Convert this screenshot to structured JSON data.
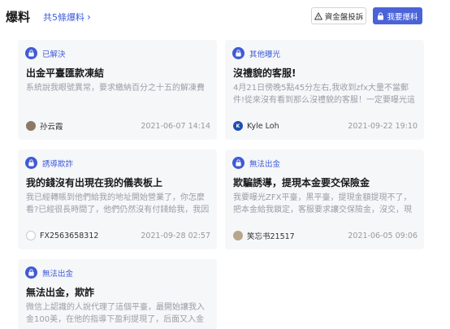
{
  "header": {
    "title": "爆料",
    "count_link": "共5條爆料",
    "complaint_button": "資金盤投訴",
    "report_button": "我要爆料"
  },
  "cards": [
    {
      "tag": "已解決",
      "title": "出金平臺匯款凍結",
      "desc": "系統說我眼號異常，要求繳納百分之十五的解凍費",
      "author": "孙云霞",
      "date": "2021-06-07 14:14"
    },
    {
      "tag": "其他曝光",
      "title": "沒禮貌的客服!",
      "desc": "4月21日傍晚5點45分左右,我收到zfx大量不當郵件!從來沒有看到那么沒禮貌的客服！一定要曝光這種垃圾...",
      "author": "Kyle Loh",
      "avatar_text": "K",
      "date": "2021-09-22 19:10"
    },
    {
      "tag": "誘導欺詐",
      "title": "我的錢沒有出現在我的儀表板上",
      "desc": "我已經轉賬到他們給我的地址開始營業了，你怎麼看?已經很長時間了，他們仍然沒有付錢給我，我因為調...",
      "author": "FX2563658312",
      "date": "2021-09-28 02:57"
    },
    {
      "tag": "無法出金",
      "title": "欺騙誘導，提現本金要交保險金",
      "desc": "我要曝光ZFX平臺，黑平臺，提現金額提現不了，把本金給我鎖定，客服要求讓交保險金，沒交，現在和客...",
      "author": "笑忘书21517",
      "date": "2021-06-05 09:06"
    },
    {
      "tag": "無法出金",
      "title": "無法出金，欺詐",
      "desc": "微信上認識的人說代理了這個平臺，最開始讓我入金100美，在他的指導下盈利提現了，后面又入金500...",
      "author": "",
      "date": ""
    }
  ],
  "colors": {
    "accent": "#3f5bd6",
    "button_primary": "#4b63d8",
    "card_bg": "#f6f7f9"
  }
}
